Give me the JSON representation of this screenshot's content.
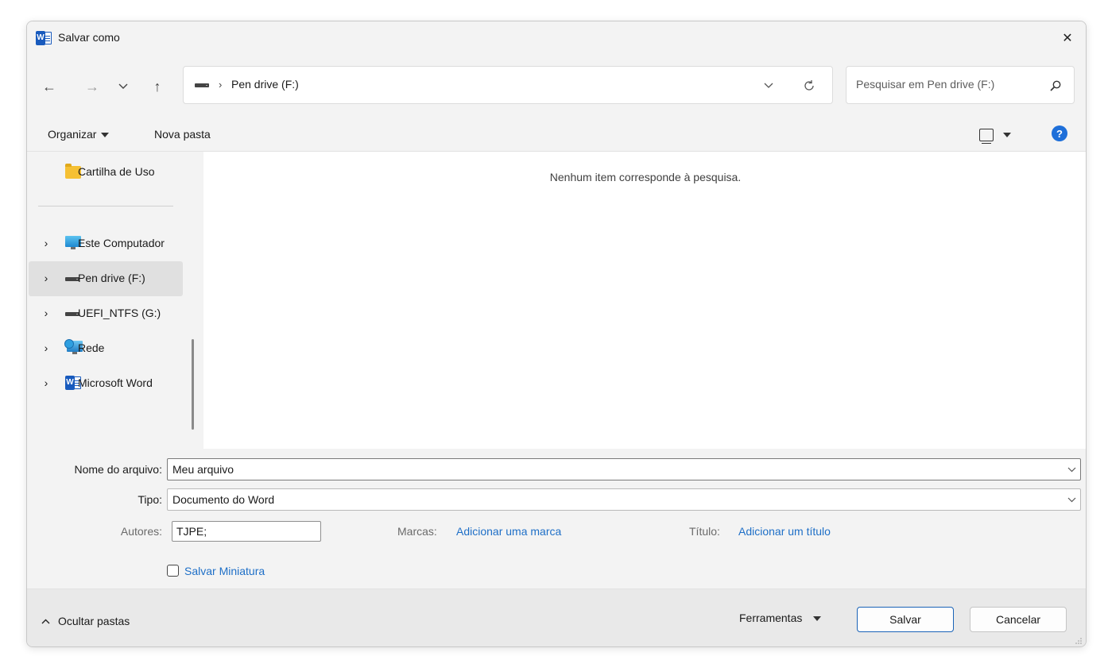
{
  "window": {
    "title": "Salvar como",
    "app_icon": "word-icon",
    "close_glyph": "✕"
  },
  "navigation": {
    "back_glyph": "←",
    "forward_glyph": "→",
    "recent_glyph": "⌵",
    "up_glyph": "↑",
    "address": {
      "separator": "›",
      "location": "Pen drive (F:)",
      "dropdown_glyph": "⌵",
      "refresh_glyph": "↻"
    },
    "search": {
      "placeholder": "Pesquisar em Pen drive (F:)"
    }
  },
  "toolbar": {
    "organize_label": "Organizar",
    "new_folder_label": "Nova pasta",
    "help_glyph": "?"
  },
  "sidebar": {
    "items": [
      {
        "label": "Cartilha de Uso",
        "icon": "folder-icon"
      },
      {
        "label": "Este Computador",
        "icon": "computer-icon"
      },
      {
        "label": "Pen drive (F:)",
        "icon": "drive-icon",
        "selected": true
      },
      {
        "label": "UEFI_NTFS (G:)",
        "icon": "drive-icon"
      },
      {
        "label": "Rede",
        "icon": "network-icon"
      },
      {
        "label": "Microsoft Word",
        "icon": "word-icon"
      }
    ],
    "chevron_glyph": "›"
  },
  "content": {
    "empty_message": "Nenhum item corresponde à pesquisa."
  },
  "form": {
    "filename_label": "Nome do arquivo:",
    "filename_value": "Meu arquivo",
    "type_label": "Tipo:",
    "type_value": "Documento do Word",
    "authors_label": "Autores:",
    "authors_value": "TJPE;",
    "tags_label": "Marcas:",
    "tags_link": "Adicionar uma marca",
    "title_label": "Título:",
    "title_link": "Adicionar um título",
    "thumbnail_label": "Salvar Miniatura",
    "thumbnail_checked": false
  },
  "footer": {
    "hide_folders_glyph": "^",
    "hide_folders_label": "Ocultar pastas",
    "tools_label": "Ferramentas",
    "save_label": "Salvar",
    "cancel_label": "Cancelar"
  },
  "colors": {
    "accent": "#1e6fc7",
    "word_blue": "#185abd",
    "dialog_bg": "#f3f3f3",
    "selection": "#e0e0e0"
  }
}
